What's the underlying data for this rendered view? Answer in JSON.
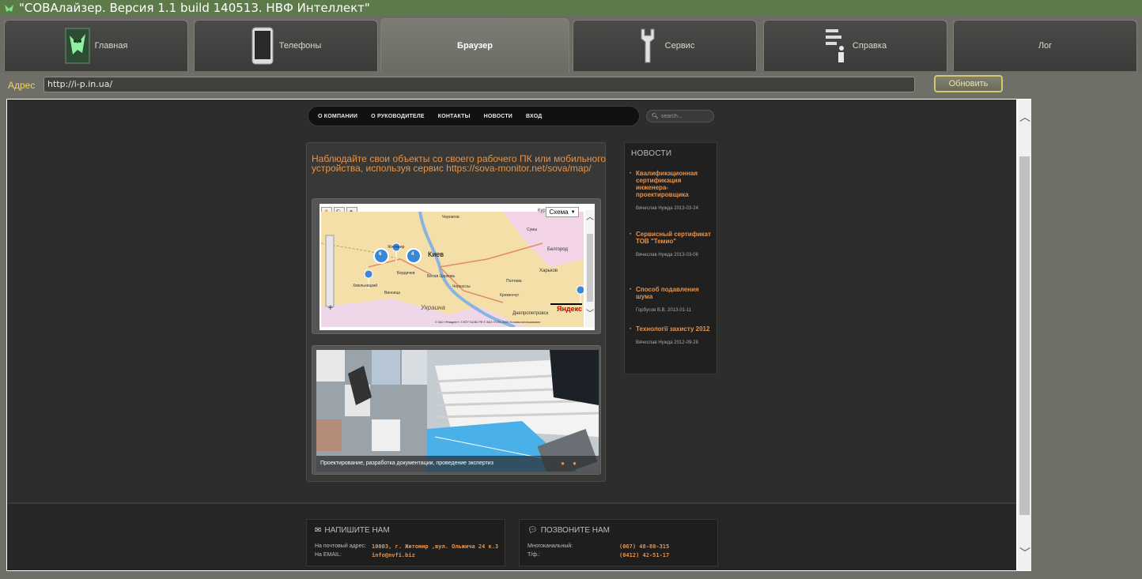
{
  "window": {
    "title": "\"СОВАлайзер. Версия 1.1 build 140513. НВФ Интеллект\""
  },
  "tabs": [
    {
      "label": "Главная",
      "icon": "owl-icon"
    },
    {
      "label": "Телефоны",
      "icon": "phone-icon"
    },
    {
      "label": "Браузер",
      "icon": "",
      "active": true
    },
    {
      "label": "Сервис",
      "icon": "wrench-icon"
    },
    {
      "label": "Справка",
      "icon": "help-icon"
    },
    {
      "label": "Лог",
      "icon": ""
    }
  ],
  "address": {
    "label": "Адрес",
    "value": "http://i-p.in.ua/",
    "refresh_label": "Обновить"
  },
  "site": {
    "nav": [
      "О КОМПАНИИ",
      "О РУКОВОДИТЕЛЕ",
      "КОНТАКТЫ",
      "НОВОСТИ",
      "ВХОД"
    ],
    "search_placeholder": "search...",
    "intro": "Наблюдайте свои объекты со своего рабочего ПК или мобильного устройства, используя сервис https://sova-monitor.net/sova/map/",
    "map": {
      "scheme_label": "Схема",
      "cities": [
        "Киев",
        "Бердичев",
        "Белая Церковь",
        "Житомир",
        "Чернигов",
        "Полтава",
        "Харьков",
        "Белгород",
        "Черкассы",
        "Хмельницкий",
        "Кременчуг",
        "Винница",
        "Днепропетровск",
        "Украина",
        "Курск",
        "Сумы"
      ],
      "markers": [
        "6",
        "4"
      ],
      "brand": "Яндекс",
      "copyright": "© ЗАО «Резидент», © ВТУ ГШ ВС РФ © ЗАО «ТГИ», 2009  Условия использования"
    },
    "slide_caption": "Проектирование, разработка документации, проведение экспертиз",
    "news": {
      "title": "НОВОСТИ",
      "items": [
        {
          "headline": "Квалификационная сертификация инженера-проектировщика",
          "meta": "Вячеслав Нужда 2013-03-24"
        },
        {
          "headline": "Сервисный сертификат ТОВ \"Темио\"",
          "meta": "Вячеслав Нужда 2013-03-06"
        },
        {
          "headline": "Способ подавления шума",
          "meta": "Горбусов В.В. 2013-01-11"
        },
        {
          "headline": "Технології захисту 2012",
          "meta": "Вячеслав Нужда 2012-09-28"
        }
      ]
    },
    "footer": {
      "write": {
        "title": "НАПИШИТЕ НАМ",
        "rows": [
          {
            "label": "На почтовый адрес:",
            "value": "10003, г. Житомир ,вул. Ольжича 24 к.3"
          },
          {
            "label": "На EMAIL:",
            "value": "info@nvfi.biz"
          }
        ]
      },
      "call": {
        "title": "ПОЗВОНИТЕ НАМ",
        "rows": [
          {
            "label": "Многоканальный:",
            "value": "(067) 48-80-315"
          },
          {
            "label": "Т/ф.:",
            "value": "(0412) 42-51-17"
          }
        ]
      }
    }
  },
  "colors": {
    "accent": "#e8934a",
    "titlebar": "#5d7a4a",
    "address_label": "#f0d36a"
  }
}
